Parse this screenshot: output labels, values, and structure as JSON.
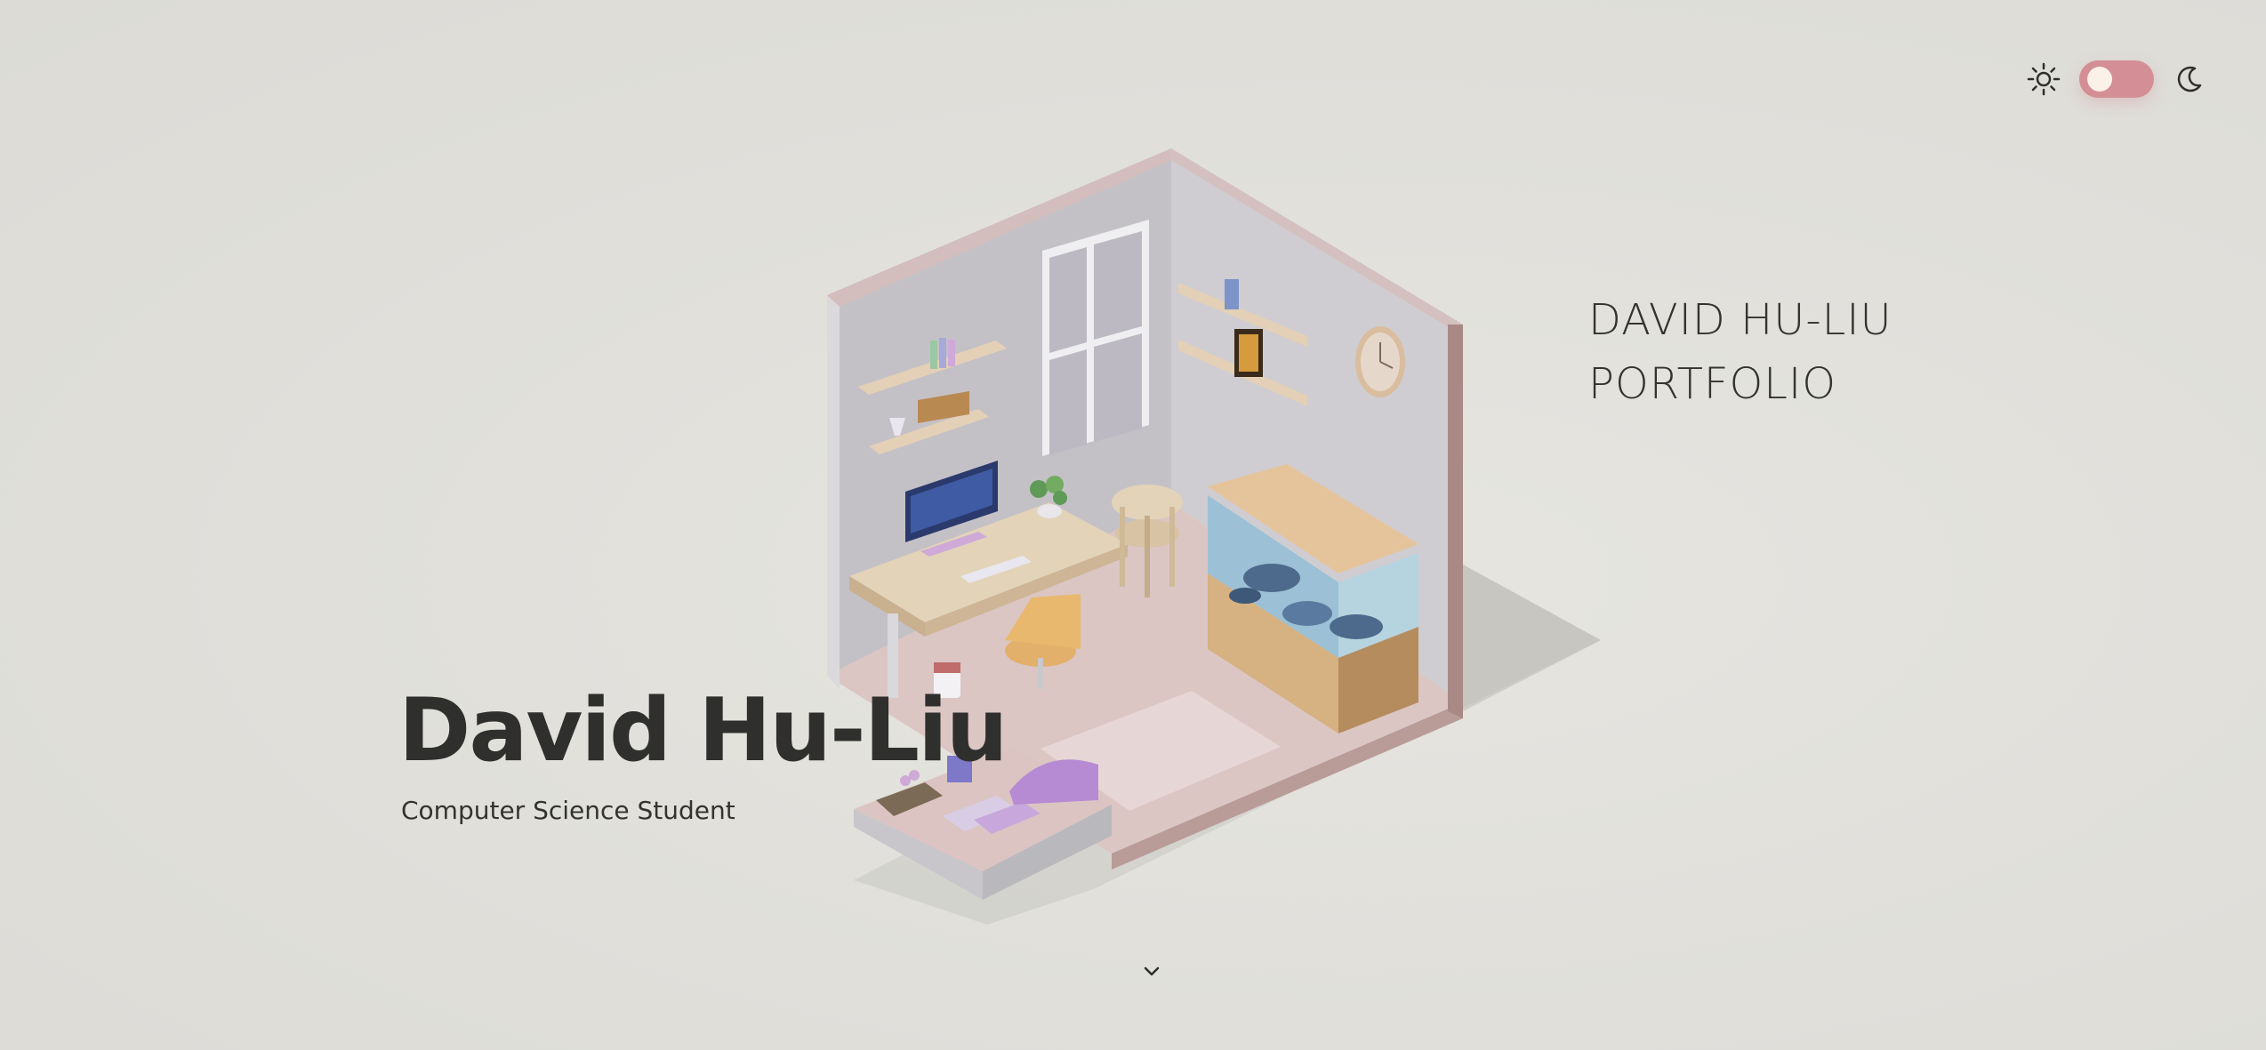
{
  "header": {
    "theme_toggle": {
      "light_icon": "sun-icon",
      "dark_icon": "moon-icon",
      "state": "light",
      "track_color": "#d48e95",
      "knob_color": "#fbf1e9"
    }
  },
  "portfolio_label": {
    "line1": "DAVID HU-LIU",
    "line2": "PORTFOLIO"
  },
  "hero": {
    "name": "David Hu-Liu",
    "subtitle": "Computer Science Student"
  },
  "scroll_indicator": {
    "icon": "chevron-down-icon"
  },
  "colors": {
    "background": "#e0dfda",
    "text": "#2f2f2d",
    "accent": "#d48e95"
  }
}
